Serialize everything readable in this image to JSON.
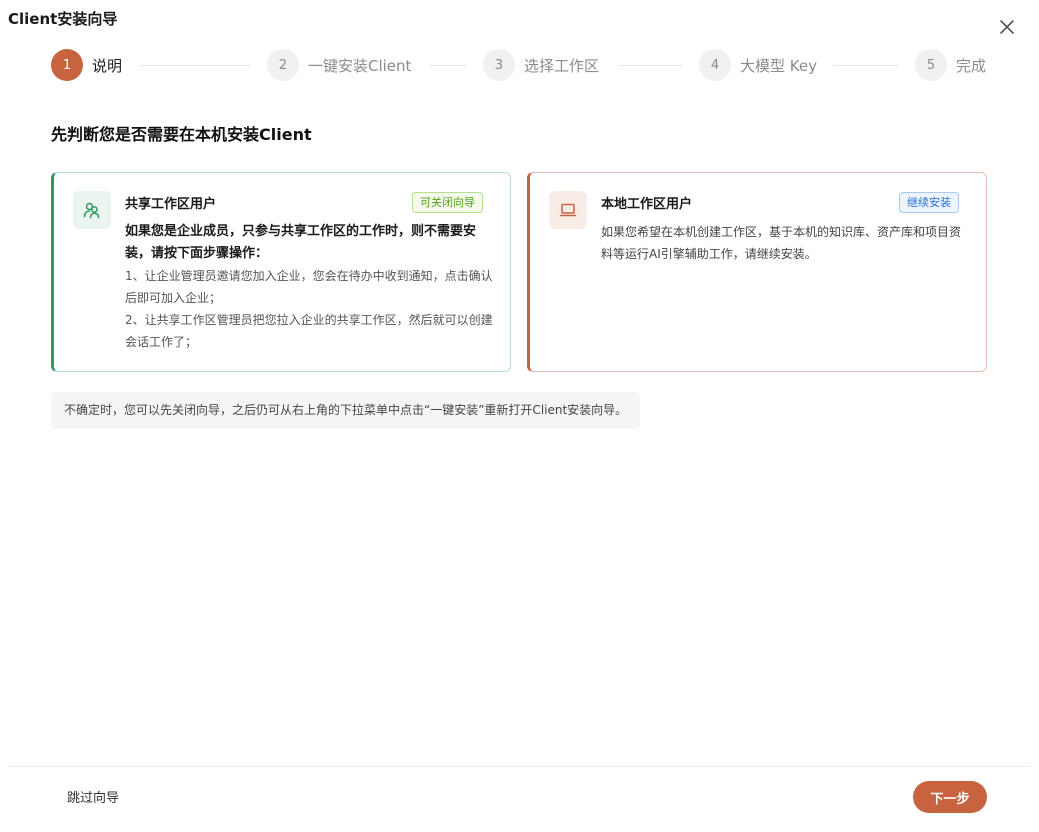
{
  "dialog": {
    "title": "Client安装向导"
  },
  "steps": [
    {
      "num": "1",
      "label": "说明",
      "active": true
    },
    {
      "num": "2",
      "label": "一键安装Client",
      "active": false
    },
    {
      "num": "3",
      "label": "选择工作区",
      "active": false
    },
    {
      "num": "4",
      "label": "大模型 Key",
      "active": false
    },
    {
      "num": "5",
      "label": "完成",
      "active": false
    }
  ],
  "heading": "先判断您是否需要在本机安装Client",
  "cards": {
    "shared": {
      "icon": "users-icon",
      "title": "共享工作区用户",
      "badge": "可关闭向导",
      "lead": "如果您是企业成员，只参与共享工作区的工作时，则不需要安装，请按下面步骤操作：",
      "step1": "1、让企业管理员邀请您加入企业，您会在待办中收到通知，点击确认后即可加入企业；",
      "step2": "2、让共享工作区管理员把您拉入企业的共享工作区，然后就可以创建会话工作了；"
    },
    "local": {
      "icon": "laptop-icon",
      "title": "本地工作区用户",
      "badge": "继续安装",
      "body": "如果您希望在本机创建工作区，基于本机的知识库、资产库和项目资料等运行AI引擎辅助工作，请继续安装。"
    }
  },
  "hint": "不确定时，您可以先关闭向导，之后仍可从右上角的下拉菜单中点击“一键安装”重新打开Client安装向导。",
  "footer": {
    "skip_label": "跳过向导",
    "next_label": "下一步"
  },
  "colors": {
    "accent": "#c8633f",
    "shared": "#2e9a62",
    "badge_green": "#52a21a",
    "badge_blue": "#2a6fd6"
  }
}
